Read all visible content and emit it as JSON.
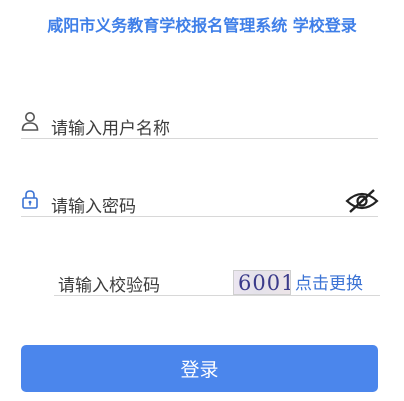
{
  "header": {
    "title": "咸阳市义务教育学校报名管理系统 学校登录",
    "accent_color": "#3f7fe8"
  },
  "form": {
    "username": {
      "placeholder": "请输入用户名称",
      "icon": "user-icon"
    },
    "password": {
      "placeholder": "请输入密码",
      "icon": "lock-icon",
      "toggle_icon": "eye-off-icon"
    },
    "captcha": {
      "placeholder": "请输入校验码",
      "image_text": "6001",
      "refresh_label": "点击更换"
    },
    "submit_label": "登录",
    "button_color": "#4b86ec"
  }
}
